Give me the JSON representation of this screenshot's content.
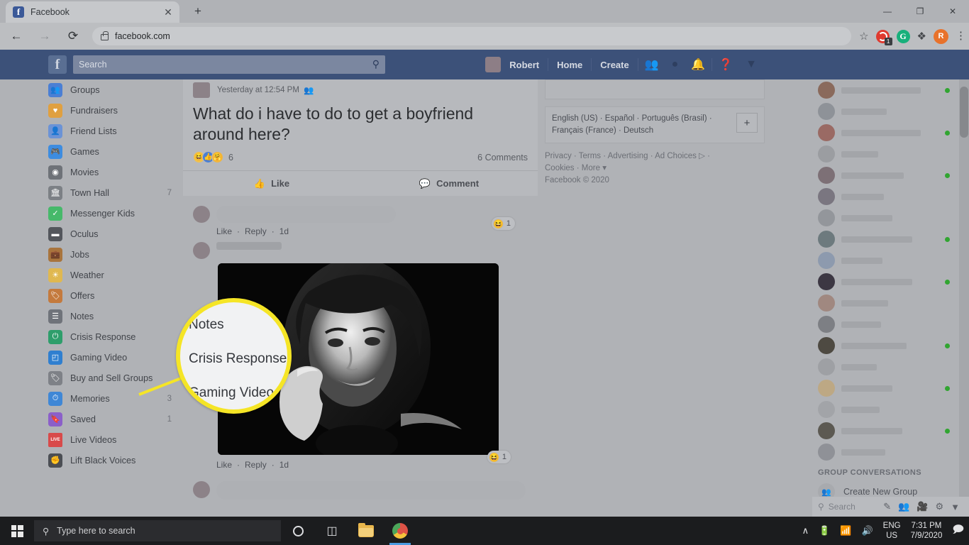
{
  "browser": {
    "tab": {
      "title": "Facebook",
      "favicon": "facebook-icon",
      "close": "✕"
    },
    "new_tab": "+",
    "window_controls": {
      "minimize": "—",
      "maximize": "❐",
      "close": "✕"
    },
    "nav": {
      "back": "←",
      "forward": "→",
      "reload": "⟳"
    },
    "omnibox": {
      "url": "facebook.com",
      "lock": "lock-icon"
    },
    "toolbar_icons": {
      "bookmark": "☆",
      "extension_badge": "1",
      "grammarly": "G",
      "puzzle": "❖",
      "profile_initial": "R",
      "menu": "⋮"
    }
  },
  "facebook": {
    "logo": "f",
    "search": {
      "placeholder": "Search",
      "icon": "search-icon"
    },
    "nav_right": {
      "profile_name": "Robert",
      "home": "Home",
      "create": "Create",
      "friends_icon": "friend-requests-icon",
      "messenger_icon": "messenger-icon",
      "notifications_icon": "bell-icon",
      "help_icon": "help-icon",
      "account_icon": "chevron-down-icon"
    },
    "sidebar": [
      {
        "label": "Groups",
        "count": "",
        "icon": "groups-icon",
        "color": "#4a7fd4"
      },
      {
        "label": "Fundraisers",
        "count": "",
        "icon": "fundraisers-icon",
        "color": "#e0a040"
      },
      {
        "label": "Friend Lists",
        "count": "",
        "icon": "friend-lists-icon",
        "color": "#6b93d6"
      },
      {
        "label": "Games",
        "count": "",
        "icon": "games-icon",
        "color": "#3d8ce0"
      },
      {
        "label": "Movies",
        "count": "",
        "icon": "movies-icon",
        "color": "#6e7278"
      },
      {
        "label": "Town Hall",
        "count": "7",
        "icon": "town-hall-icon",
        "color": "#7c8085"
      },
      {
        "label": "Messenger Kids",
        "count": "",
        "icon": "messenger-kids-icon",
        "color": "#46b96a"
      },
      {
        "label": "Oculus",
        "count": "",
        "icon": "oculus-icon",
        "color": "#53565c"
      },
      {
        "label": "Jobs",
        "count": "",
        "icon": "jobs-icon",
        "color": "#a8743d"
      },
      {
        "label": "Weather",
        "count": "",
        "icon": "weather-icon",
        "color": "#e0b850"
      },
      {
        "label": "Offers",
        "count": "",
        "icon": "offers-icon",
        "color": "#c47a3d"
      },
      {
        "label": "Notes",
        "count": "",
        "icon": "notes-icon",
        "color": "#6f737a"
      },
      {
        "label": "Crisis Response",
        "count": "",
        "icon": "crisis-response-icon",
        "color": "#2e9e6b"
      },
      {
        "label": "Gaming Video",
        "count": "",
        "icon": "gaming-video-icon",
        "color": "#2f7fd0"
      },
      {
        "label": "Buy and Sell Groups",
        "count": "",
        "icon": "buy-sell-groups-icon",
        "color": "#7e8187"
      },
      {
        "label": "Memories",
        "count": "3",
        "icon": "memories-icon",
        "color": "#3f87d6"
      },
      {
        "label": "Saved",
        "count": "1",
        "icon": "saved-icon",
        "color": "#8b5fc9"
      },
      {
        "label": "Live Videos",
        "count": "",
        "icon": "live-videos-icon",
        "color": "#d84a4a"
      },
      {
        "label": "Lift Black Voices",
        "count": "",
        "icon": "lift-black-voices-icon",
        "color": "#4b4e54"
      }
    ],
    "post": {
      "timestamp": "Yesterday at 12:54 PM",
      "audience_icon": "friends-audience-icon",
      "title": "What do i have to do to get a boyfriend around here?",
      "reaction_count": "6",
      "comment_count": "6 Comments",
      "like_label": "Like",
      "comment_label": "Comment",
      "like_icon": "thumbs-up-icon",
      "comment_icon": "comment-bubble-icon"
    },
    "comments": [
      {
        "like": "Like",
        "reply": "Reply",
        "time": "1d",
        "reaction": "haha",
        "reaction_count": "1"
      },
      {
        "like": "Like",
        "reply": "Reply",
        "time": "1d",
        "reaction": "haha",
        "reaction_count": "1"
      }
    ],
    "footer": {
      "languages": [
        "English (US)",
        "Español",
        "Português (Brasil)",
        "Français (France)",
        "Deutsch"
      ],
      "add_language": "+",
      "legal_links": [
        "Privacy",
        "Terms",
        "Advertising",
        "Ad Choices",
        "Cookies",
        "More"
      ],
      "copyright": "Facebook © 2020"
    },
    "chat": {
      "group_header": "GROUP CONVERSATIONS",
      "create_group": "Create New Group",
      "search_placeholder": "Search",
      "footer_icons": [
        "new-message-icon",
        "new-group-icon",
        "video-room-icon",
        "settings-gear-icon",
        "collapse-icon"
      ],
      "contacts": [
        {
          "online": true,
          "name_w": 112,
          "av": "#8a6a5c"
        },
        {
          "online": false,
          "name_w": 64,
          "av": "#8e9298"
        },
        {
          "online": true,
          "name_w": 112,
          "av": "#9a6a64"
        },
        {
          "online": false,
          "name_w": 52,
          "av": "#9b9da1"
        },
        {
          "online": true,
          "name_w": 88,
          "av": "#7d7076"
        },
        {
          "online": false,
          "name_w": 60,
          "av": "#7a7680"
        },
        {
          "online": false,
          "name_w": 72,
          "av": "#93969b"
        },
        {
          "online": true,
          "name_w": 100,
          "av": "#6d7a7e"
        },
        {
          "online": false,
          "name_w": 58,
          "av": "#8d9aae"
        },
        {
          "online": true,
          "name_w": 100,
          "av": "#3c3743"
        },
        {
          "online": false,
          "name_w": 66,
          "av": "#a08880"
        },
        {
          "online": false,
          "name_w": 56,
          "av": "#7d7f84"
        },
        {
          "online": true,
          "name_w": 92,
          "av": "#4e4a42"
        },
        {
          "online": false,
          "name_w": 50,
          "av": "#9ea0a4"
        },
        {
          "online": true,
          "name_w": 72,
          "av": "#bda884"
        },
        {
          "online": false,
          "name_w": 54,
          "av": "#a2a4a8"
        },
        {
          "online": true,
          "name_w": 86,
          "av": "#5c5952"
        },
        {
          "online": false,
          "name_w": 62,
          "av": "#8f9197"
        }
      ]
    }
  },
  "magnifier": {
    "lines": [
      "Notes",
      "Crisis Response",
      "Gaming Video"
    ],
    "highlight_color": "#f5e526"
  },
  "taskbar": {
    "start": "windows-start-icon",
    "search_placeholder": "Type here to search",
    "search_icon": "search-icon",
    "cortana": "cortana-icon",
    "task_view": "task-view-icon",
    "file_explorer": "file-explorer-icon",
    "chrome": "chrome-icon",
    "tray": {
      "chevron": "∧",
      "battery": "battery-icon",
      "wifi": "wifi-icon",
      "volume": "volume-icon",
      "lang_line1": "ENG",
      "lang_line2": "US",
      "time": "7:31 PM",
      "date": "7/9/2020",
      "action_center": "action-center-icon"
    }
  }
}
